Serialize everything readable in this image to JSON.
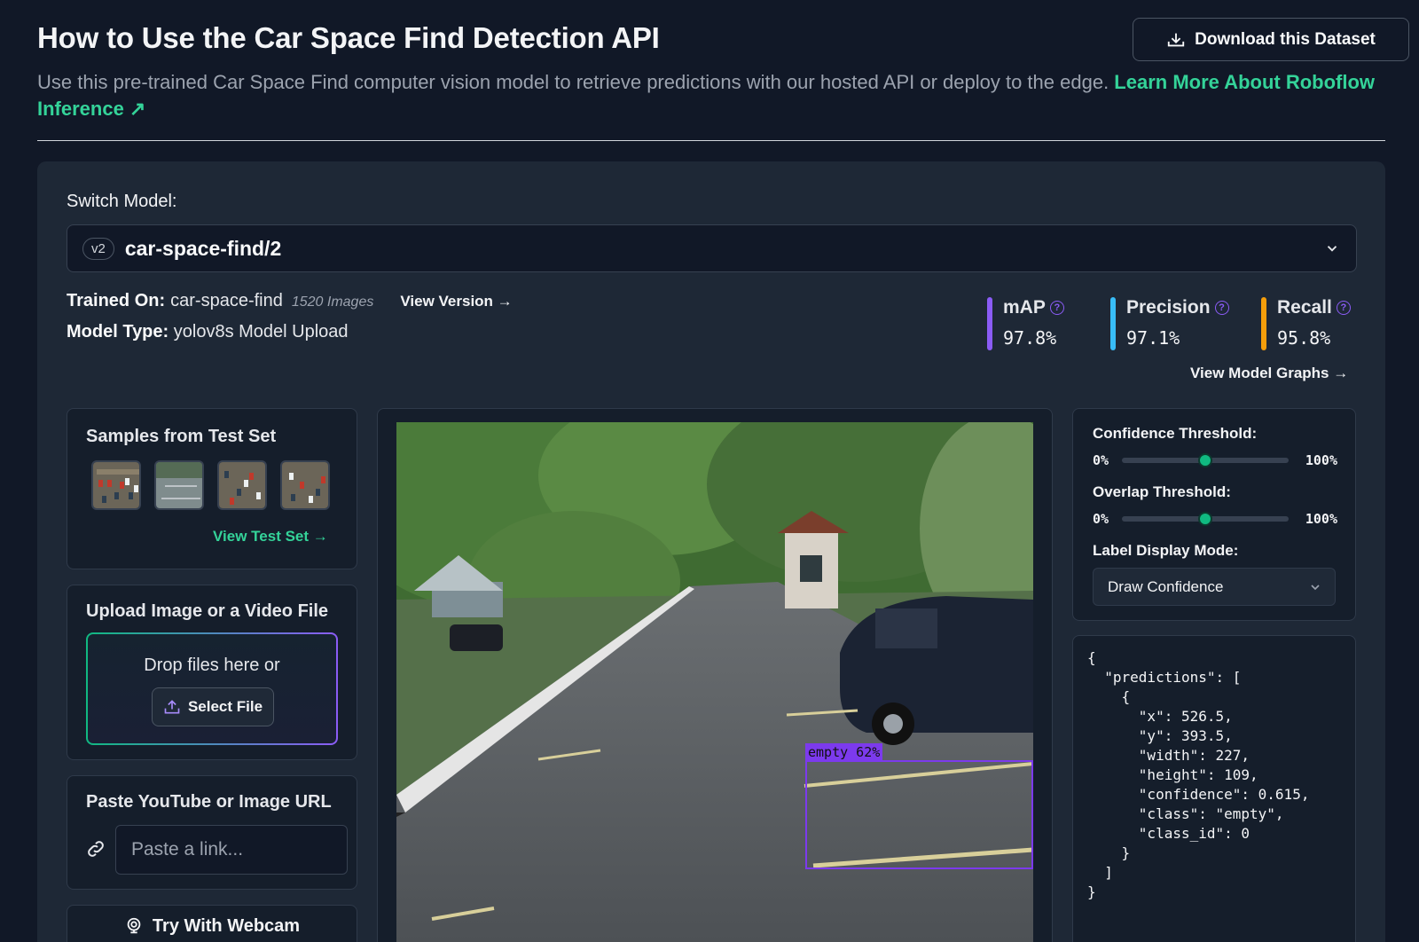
{
  "header": {
    "title": "How to Use the Car Space Find Detection API",
    "download_label": "Download this Dataset",
    "subtitle": "Use this pre-trained Car Space Find computer vision model to retrieve predictions with our hosted API or deploy to the edge. ",
    "learn_more": "Learn More About Roboflow Inference ↗"
  },
  "model": {
    "switch_label": "Switch Model:",
    "version_chip": "v2",
    "name": "car-space-find/2",
    "trained_on_label": "Trained On:",
    "trained_on_value": "car-space-find",
    "image_count": "1520 Images",
    "view_version": "View Version →",
    "type_label": "Model Type:",
    "type_value": "yolov8s Model Upload",
    "view_graphs": "View Model Graphs →"
  },
  "metrics": [
    {
      "name": "mAP",
      "value": "97.8%",
      "color": "#8b5cf6"
    },
    {
      "name": "Precision",
      "value": "97.1%",
      "color": "#38bdf8"
    },
    {
      "name": "Recall",
      "value": "95.8%",
      "color": "#f59e0b"
    }
  ],
  "samples": {
    "title": "Samples from Test Set",
    "view_test_set": "View Test Set →"
  },
  "upload": {
    "title": "Upload Image or a Video File",
    "drop_text": "Drop files here or",
    "select_file": "Select File"
  },
  "url": {
    "title": "Paste YouTube or Image URL",
    "placeholder": "Paste a link..."
  },
  "webcam": {
    "label": "Try With Webcam"
  },
  "detection": {
    "label": "empty 62%"
  },
  "settings": {
    "confidence_label": "Confidence Threshold:",
    "overlap_label": "Overlap Threshold:",
    "range_min": "0%",
    "range_max": "100%",
    "confidence_value": 0.5,
    "overlap_value": 0.5,
    "display_mode_label": "Label Display Mode:",
    "display_mode_value": "Draw Confidence"
  },
  "output_json": "{\n  \"predictions\": [\n    {\n      \"x\": 526.5,\n      \"y\": 393.5,\n      \"width\": 227,\n      \"height\": 109,\n      \"confidence\": 0.615,\n      \"class\": \"empty\",\n      \"class_id\": 0\n    }\n  ]\n}",
  "colors": {
    "accent_green": "#34d399",
    "slider_green": "#10b981",
    "detection_purple": "#7c3aed"
  }
}
